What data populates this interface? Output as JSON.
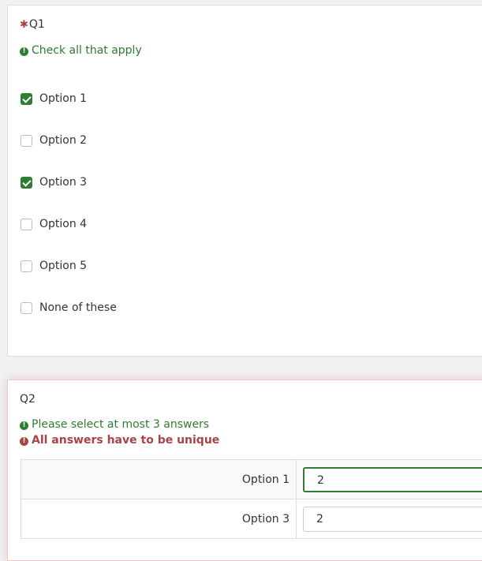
{
  "q1": {
    "mandatory_mark": "✱",
    "title": "Q1",
    "tip": "Check all that apply",
    "options": [
      {
        "label": "Option 1",
        "checked": true
      },
      {
        "label": "Option 2",
        "checked": false
      },
      {
        "label": "Option 3",
        "checked": true
      },
      {
        "label": "Option 4",
        "checked": false
      },
      {
        "label": "Option 5",
        "checked": false
      },
      {
        "label": "None of these",
        "checked": false
      }
    ]
  },
  "q2": {
    "title": "Q2",
    "tip": "Please select at most 3 answers",
    "error": "All answers have to be unique",
    "rows": [
      {
        "label": "Option 1",
        "value": "2"
      },
      {
        "label": "Option 3",
        "value": "2"
      }
    ]
  },
  "icons": {
    "tip_icon": "exclamation-circle-icon"
  },
  "colors": {
    "accent_green": "#2e7d32",
    "error_red": "#a94442"
  }
}
